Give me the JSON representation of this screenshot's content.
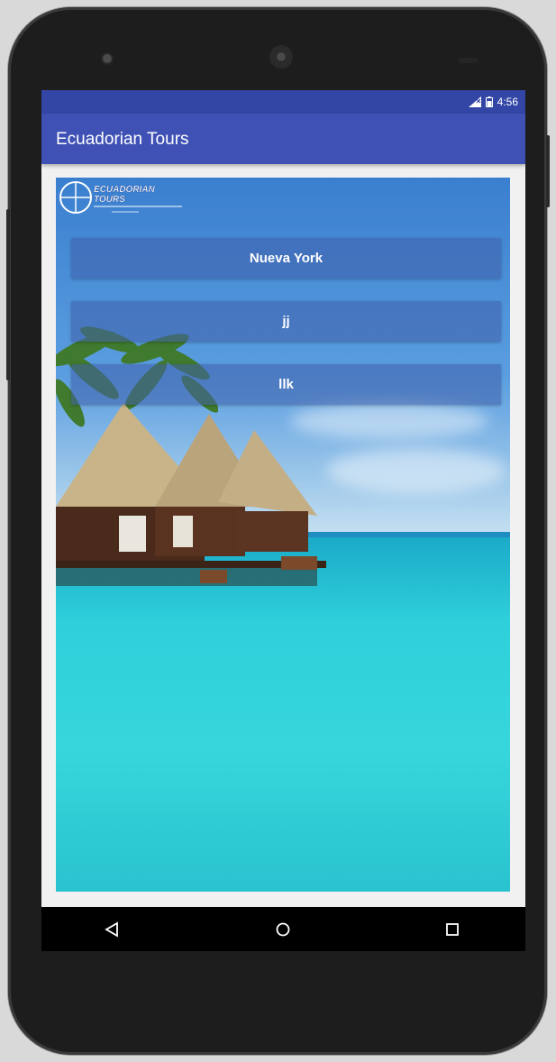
{
  "status_bar": {
    "time": "4:56",
    "signal_icon": "signal-icon",
    "battery_icon": "battery-icon"
  },
  "app_bar": {
    "title": "Ecuadorian Tours"
  },
  "logo": {
    "name": "ecuadorian-tours-logo",
    "text_line1": "ECUADORIAN",
    "text_line2": "TOURS"
  },
  "destinations": [
    {
      "label": "Nueva York"
    },
    {
      "label": "jj"
    },
    {
      "label": "llk"
    }
  ],
  "nav_bar": {
    "back_icon": "back-triangle-icon",
    "home_icon": "home-circle-icon",
    "recents_icon": "recents-square-icon"
  },
  "colors": {
    "status_bar": "#3346a6",
    "app_bar": "#3f51b5",
    "button_bg": "rgba(63,94,170,0.55)",
    "nav_bar": "#000000"
  }
}
